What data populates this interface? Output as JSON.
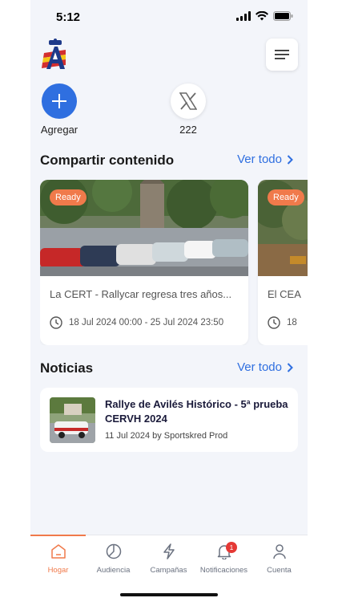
{
  "status_bar": {
    "time": "5:12"
  },
  "quick_actions": [
    {
      "label": "Agregar",
      "icon": "plus-icon",
      "color": "#2f6fe0"
    },
    {
      "label": "222",
      "icon": "x-logo-icon"
    }
  ],
  "share_section": {
    "title": "Compartir contenido",
    "see_all": "Ver todo",
    "cards": [
      {
        "badge": "Ready",
        "title": "La CERT - Rallycar regresa tres años...",
        "dates": "18 Jul 2024 00:00 - 25 Jul 2024 23:50"
      },
      {
        "badge": "Ready",
        "title": "El CEA",
        "dates": "18"
      }
    ]
  },
  "news_section": {
    "title": "Noticias",
    "see_all": "Ver todo",
    "items": [
      {
        "title": "Rallye de Avilés Histórico - 5ª prueba CERVH 2024",
        "meta": "11 Jul 2024 by Sportskred Prod"
      }
    ]
  },
  "tabbar": {
    "tabs": [
      {
        "label": "Hogar",
        "icon": "home-icon",
        "active": true
      },
      {
        "label": "Audiencia",
        "icon": "pie-chart-icon"
      },
      {
        "label": "Campañas",
        "icon": "lightning-icon"
      },
      {
        "label": "Notificaciones",
        "icon": "bell-icon",
        "badge": "1"
      },
      {
        "label": "Cuenta",
        "icon": "user-icon"
      }
    ]
  },
  "colors": {
    "accent": "#f07a4b",
    "link": "#2f6fe0",
    "background": "#f3f5fa"
  }
}
